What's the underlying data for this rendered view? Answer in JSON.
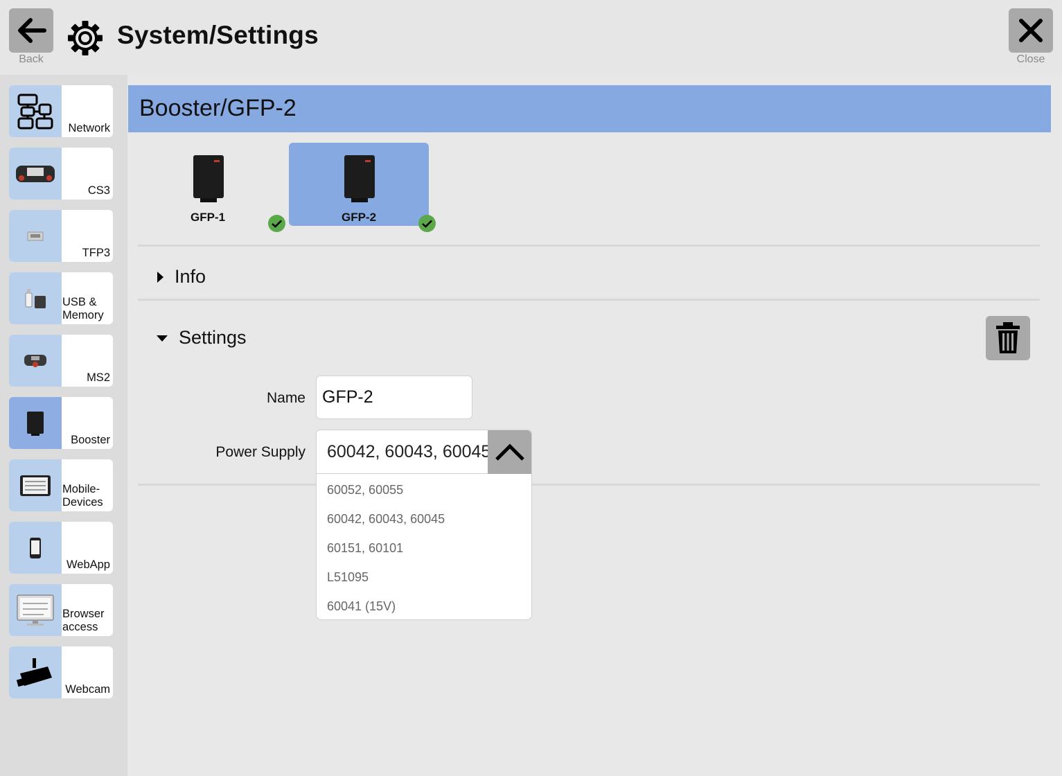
{
  "header": {
    "title": "System/Settings",
    "back_label": "Back",
    "close_label": "Close"
  },
  "sidebar": {
    "items": [
      {
        "label": "Network",
        "icon": "network-icon"
      },
      {
        "label": "CS3",
        "icon": "cs3-icon"
      },
      {
        "label": "TFP3",
        "icon": "tfp3-icon"
      },
      {
        "label": "USB & Memory",
        "icon": "usb-memory-icon"
      },
      {
        "label": "MS2",
        "icon": "ms2-icon"
      },
      {
        "label": "Booster",
        "icon": "booster-icon",
        "active": true
      },
      {
        "label": "Mobile-Devices",
        "icon": "mobile-devices-icon"
      },
      {
        "label": "WebApp",
        "icon": "webapp-icon"
      },
      {
        "label": "Browser access",
        "icon": "browser-access-icon"
      },
      {
        "label": "Webcam",
        "icon": "webcam-icon"
      }
    ]
  },
  "main": {
    "title": "Booster/GFP-2",
    "devices": [
      {
        "label": "GFP-1",
        "selected": false,
        "status": "ok"
      },
      {
        "label": "GFP-2",
        "selected": true,
        "status": "ok"
      }
    ],
    "sections": {
      "info_label": "Info",
      "settings_label": "Settings"
    },
    "form": {
      "name_label": "Name",
      "name_value": "GFP-2",
      "power_supply_label": "Power Supply",
      "power_supply_value": "60042, 60043, 60045",
      "power_supply_options": [
        "60052, 60055",
        "60042, 60043, 60045",
        "60151, 60101",
        "L51095",
        "60041 (15V)"
      ]
    }
  },
  "colors": {
    "accent": "#87a9e2",
    "sidebar_thumb": "#b8d0ec",
    "button_gray": "#a9a9a9",
    "ok_green": "#5aa84a"
  }
}
